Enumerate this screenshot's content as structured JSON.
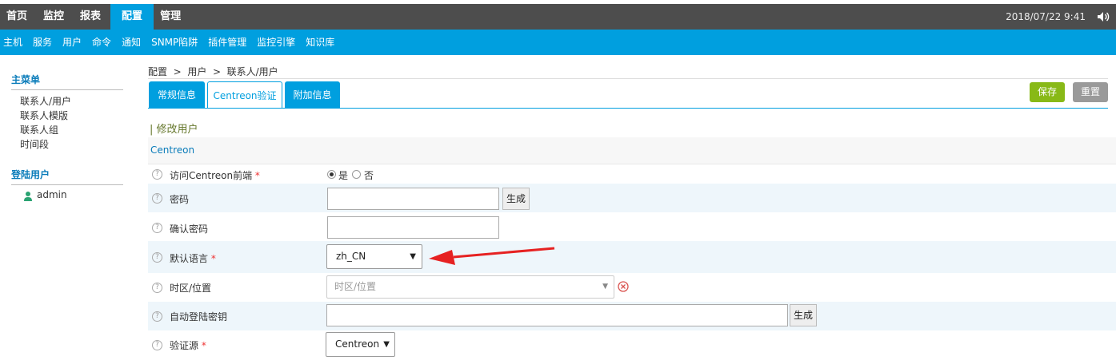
{
  "topnav": {
    "items": [
      "首页",
      "监控",
      "报表",
      "配置",
      "管理"
    ],
    "active": "配置",
    "datetime": "2018/07/22 9:41"
  },
  "subnav": [
    "主机",
    "服务",
    "用户",
    "命令",
    "通知",
    "SNMP陷阱",
    "插件管理",
    "监控引擎",
    "知识库"
  ],
  "sidebar": {
    "main_menu_title": "主菜单",
    "items": [
      "联系人/用户",
      "联系人模版",
      "联系人组",
      "时间段"
    ],
    "login_title": "登陆用户",
    "user": "admin"
  },
  "breadcrumb": "配置  >  用户  >  联系人/用户",
  "tabs": [
    "常规信息",
    "Centreon验证",
    "附加信息"
  ],
  "actions": {
    "save": "保存",
    "reset": "重置"
  },
  "section_title": "| 修改用户",
  "section_header": "Centreon",
  "form": {
    "access_label": "访问Centreon前端",
    "yes": "是",
    "no": "否",
    "password_label": "密码",
    "generate": "生成",
    "confirm_label": "确认密码",
    "language_label": "默认语言",
    "language_value": "zh_CN",
    "timezone_label": "时区/位置",
    "timezone_placeholder": "时区/位置",
    "autologin_label": "自动登陆密钥",
    "auth_label": "验证源",
    "auth_value": "Centreon",
    "required_mark": "*"
  },
  "colors": {
    "accent": "#009fdf",
    "topbar": "#4d4d4d",
    "save": "#88b917",
    "annotation_arrow": "#e62222"
  }
}
